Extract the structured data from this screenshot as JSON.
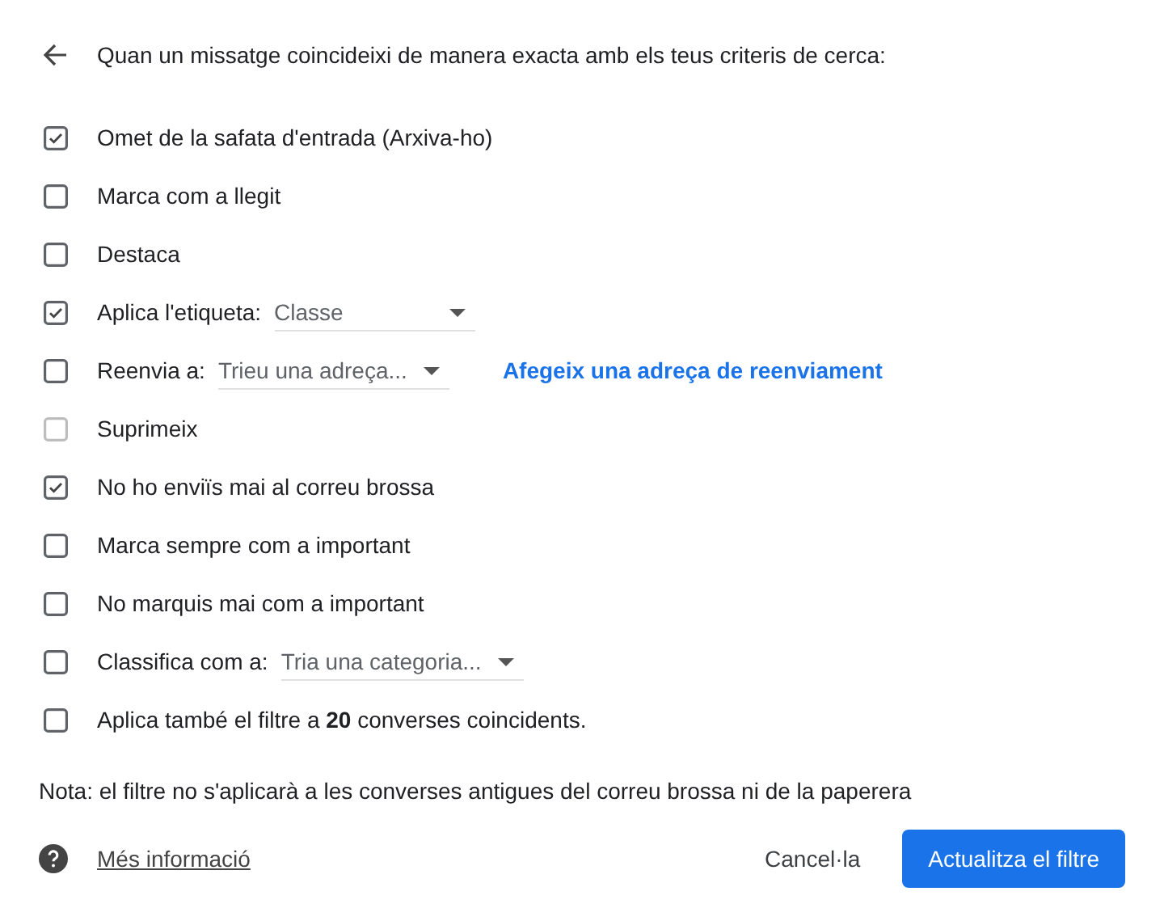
{
  "header": {
    "title": "Quan un missatge coincideixi de manera exacta amb els teus criteris de cerca:"
  },
  "actions": [
    {
      "label": "Omet de la safata d'entrada (Arxiva-ho)",
      "checked": true,
      "disabled": false
    },
    {
      "label": "Marca com a llegit",
      "checked": false,
      "disabled": false
    },
    {
      "label": "Destaca",
      "checked": false,
      "disabled": false
    },
    {
      "label": "Aplica l'etiqueta:",
      "checked": true,
      "disabled": false,
      "dropdown": {
        "value": "Classe"
      }
    },
    {
      "label": "Reenvia a:",
      "checked": false,
      "disabled": false,
      "dropdown": {
        "value": "Trieu una adreça..."
      },
      "link": "Afegeix una adreça de reenviament"
    },
    {
      "label": "Suprimeix",
      "checked": false,
      "disabled": true
    },
    {
      "label": "No ho enviïs mai al correu brossa",
      "checked": true,
      "disabled": false
    },
    {
      "label": "Marca sempre com a important",
      "checked": false,
      "disabled": false
    },
    {
      "label": "No marquis mai com a important",
      "checked": false,
      "disabled": false
    },
    {
      "label": "Classifica com a:",
      "checked": false,
      "disabled": false,
      "dropdown": {
        "value": "Tria una categoria..."
      }
    },
    {
      "label": "Aplica també el filtre a **20** converses coincidents.",
      "checked": false,
      "disabled": false
    }
  ],
  "note": "Nota: el filtre no s'aplicarà a les converses antigues del correu brossa ni de la paperera",
  "footer": {
    "help_link": "Més informació",
    "buttons": [
      {
        "label": "Cancel·la",
        "kind": "text"
      },
      {
        "label": "Actualitza el filtre",
        "kind": "primary"
      }
    ]
  }
}
